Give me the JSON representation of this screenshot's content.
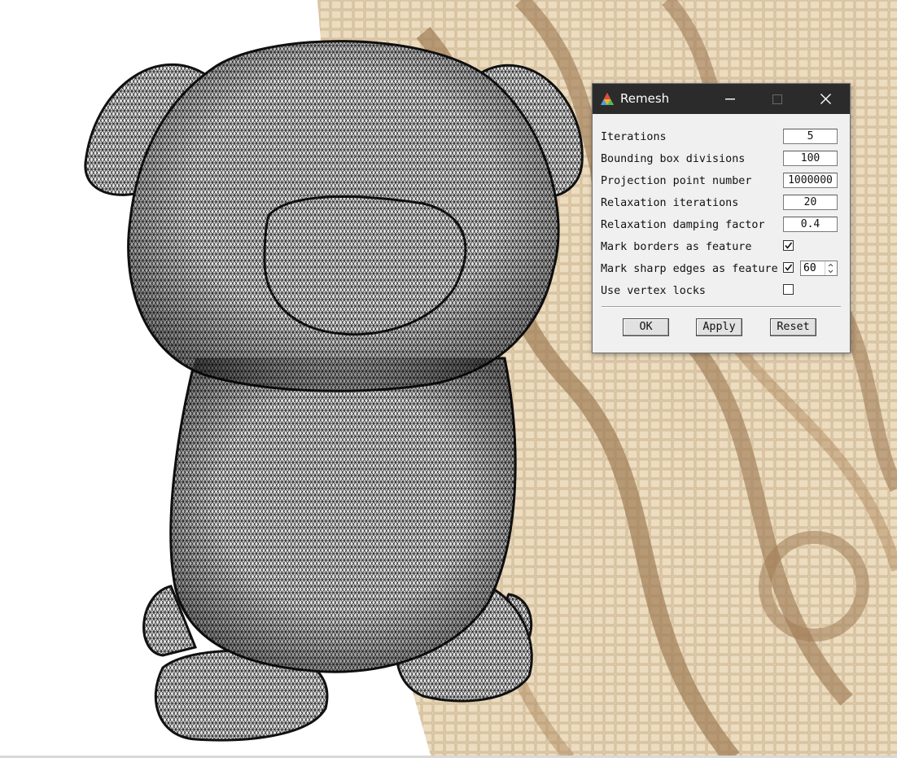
{
  "dialog": {
    "title": "Remesh",
    "fields": [
      {
        "label": "Iterations",
        "value": "5"
      },
      {
        "label": "Bounding box divisions",
        "value": "100"
      },
      {
        "label": "Projection point number",
        "value": "1000000"
      },
      {
        "label": "Relaxation iterations",
        "value": "20"
      },
      {
        "label": "Relaxation damping factor",
        "value": "0.4"
      }
    ],
    "checks": [
      {
        "label": "Mark borders as feature",
        "checked": true
      },
      {
        "label": "Mark sharp edges as feature",
        "checked": true,
        "angle": "60"
      },
      {
        "label": "Use vertex locks",
        "checked": false
      }
    ],
    "buttons": {
      "ok": "OK",
      "apply": "Apply",
      "reset": "Reset"
    }
  },
  "colors": {
    "titlebar": "#2b2b2b",
    "dialog_bg": "#f0f0f0",
    "floor": "#e3d1b2",
    "floor_dark": "#a07c56",
    "mesh_fill": "#e4e4e4",
    "mesh_line": "#1a1a1a"
  },
  "icons": {
    "app": "meshlab-triangle-icon",
    "minimize": "minimize-icon",
    "maximize": "maximize-icon",
    "close": "close-icon"
  }
}
